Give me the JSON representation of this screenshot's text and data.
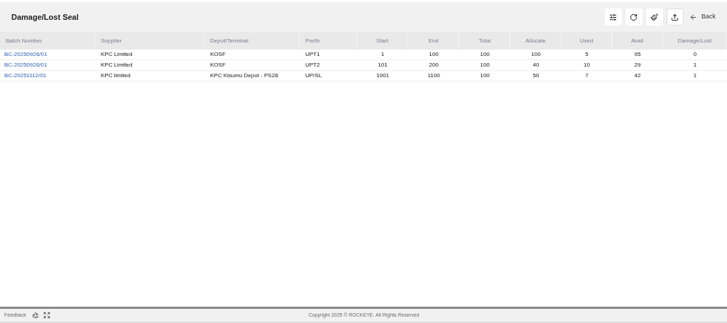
{
  "page": {
    "title": "Damage/Lost Seal",
    "back": "Back"
  },
  "table": {
    "columns": [
      "Batch Number",
      "Supplier",
      "Depot/Terminal",
      "Prefix",
      "Start",
      "End",
      "Total",
      "Allocate",
      "Used",
      "Avail",
      "Damage/Lost"
    ],
    "rows": [
      [
        "BC-20250926/01",
        "KPC Limited",
        "KOSF",
        "UPT1",
        "1",
        "100",
        "100",
        "100",
        "5",
        "95",
        "0"
      ],
      [
        "BC-20250926/01",
        "KPC Limited",
        "KOSF",
        "UPT2",
        "101",
        "200",
        "100",
        "40",
        "10",
        "29",
        "1"
      ],
      [
        "BC-20251112/01",
        "KPC limited",
        "KPC Kisumu Depot - PS28",
        "UP/SL",
        "1001",
        "1100",
        "100",
        "50",
        "7",
        "42",
        "1"
      ]
    ]
  },
  "footer": {
    "feedback": "Feedback",
    "copyright": "Copyright 2025 © ROCKEYE. All Rights Reserved"
  }
}
